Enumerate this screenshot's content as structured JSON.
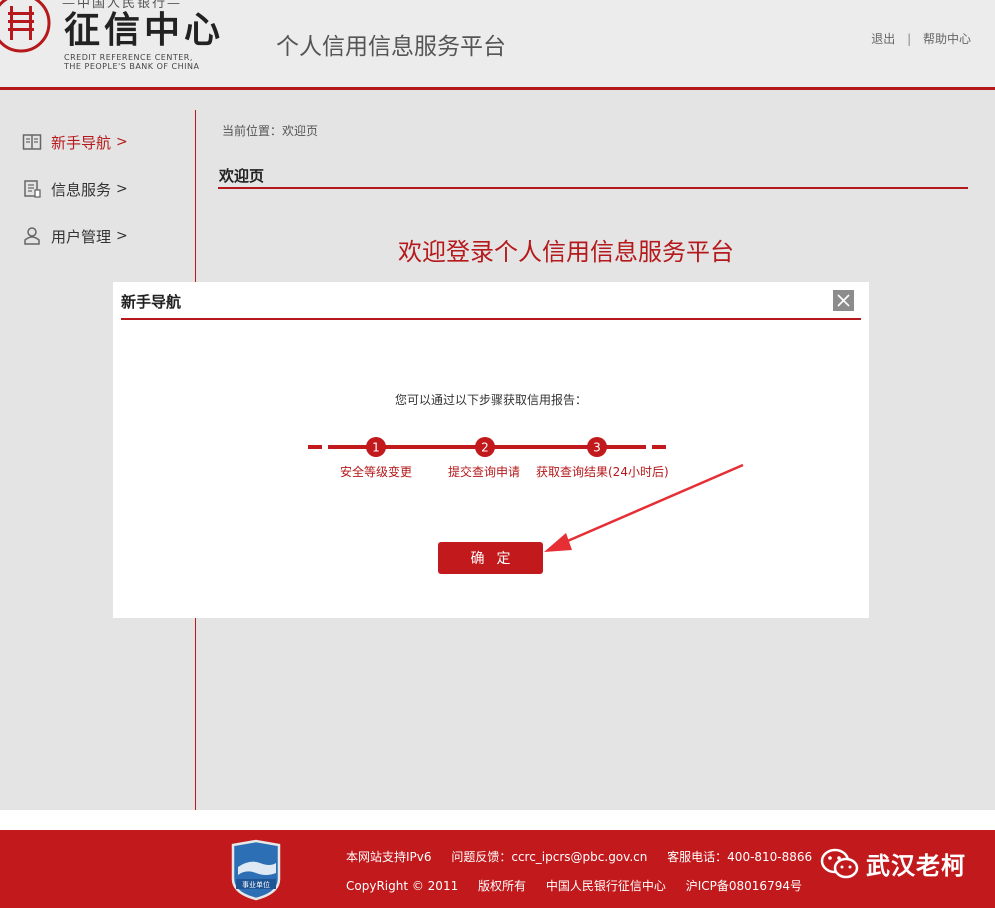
{
  "header": {
    "logo_top": "—中国人民银行—",
    "logo_main": "征信中心",
    "logo_en_1": "CREDIT REFERENCE CENTER,",
    "logo_en_2": "THE PEOPLE'S BANK OF CHINA",
    "platform_title": "个人信用信息服务平台",
    "links": {
      "logout": "退出",
      "separator": "|",
      "help": "帮助中心"
    }
  },
  "sidebar": {
    "items": [
      {
        "label": "新手导航",
        "arrow": ">",
        "icon": "book-icon",
        "active": true
      },
      {
        "label": "信息服务",
        "arrow": ">",
        "icon": "document-icon",
        "active": false
      },
      {
        "label": "用户管理",
        "arrow": ">",
        "icon": "user-icon",
        "active": false
      }
    ]
  },
  "main": {
    "breadcrumb": "当前位置：欢迎页",
    "page_title": "欢迎页",
    "welcome_text": "欢迎登录个人信用信息服务平台"
  },
  "modal": {
    "title": "新手导航",
    "close_icon": "close-icon",
    "instruction": "您可以通过以下步骤获取信用报告：",
    "steps": [
      {
        "number": "1",
        "label": "安全等级变更"
      },
      {
        "number": "2",
        "label": "提交查询申请"
      },
      {
        "number": "3",
        "label": "获取查询结果(24小时后)"
      }
    ],
    "confirm_label": "确定"
  },
  "footer": {
    "badge_text": "事业单位",
    "ipv6": "本网站支持IPv6",
    "feedback": "问题反馈：ccrc_ipcrs@pbc.gov.cn",
    "phone": "客服电话：400-810-8866",
    "copyright": "CopyRight © 2011",
    "rights": "版权所有",
    "org": "中国人民银行征信中心",
    "icp": "沪ICP备08016794号",
    "wechat_name": "武汉老柯"
  },
  "colors": {
    "brand_red": "#b5191b",
    "button_red": "#c1191c",
    "page_bg": "#e4e4e4"
  }
}
